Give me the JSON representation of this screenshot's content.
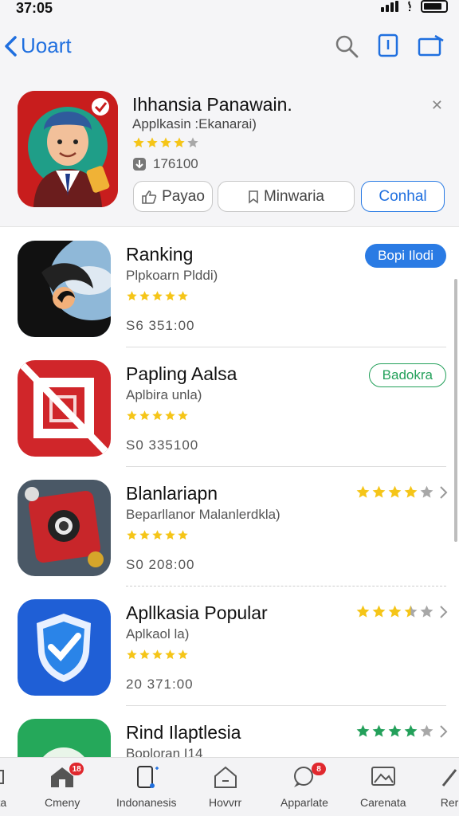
{
  "status": {
    "time": "37:05"
  },
  "header": {
    "back_label": "Uoart"
  },
  "featured": {
    "title": "Ihhansia Panawain.",
    "subtitle": "Applkasin :Ekanarai)",
    "rating": 4,
    "size": "176100",
    "buttons": {
      "first": "Payao",
      "second": "Minwaria",
      "third": "Conhal"
    }
  },
  "apps": [
    {
      "title": "Ranking",
      "subtitle": "Plpkoarn Plddi)",
      "rating": 5,
      "size": "S6  351:00",
      "action": {
        "type": "button",
        "label": "Bopi Ilodi"
      }
    },
    {
      "title": "Papling Aalsa",
      "subtitle": "Aplbira unla)",
      "rating": 5,
      "size": "S0  335100",
      "action": {
        "type": "outline",
        "label": "Badokra"
      }
    },
    {
      "title": "Blanlariapn",
      "subtitle": "Beparllanor Malanlerdkla)",
      "rating": 5,
      "size": "S0  208:00",
      "action": {
        "type": "rating",
        "rating": 4
      }
    },
    {
      "title": "Apllkasia Popular",
      "subtitle": "Aplkaol la)",
      "rating": 5,
      "size": "20  371:00",
      "action": {
        "type": "rating",
        "rating": 3.5
      }
    },
    {
      "title": "Rind Ilaptlesia",
      "subtitle": "Boploran I14",
      "action": {
        "type": "rating",
        "rating": 4,
        "color": "green"
      }
    }
  ],
  "tabs": [
    {
      "label": "rta"
    },
    {
      "label": "Cmeny",
      "badge": "18"
    },
    {
      "label": "Indonanesis"
    },
    {
      "label": "Hovvrr"
    },
    {
      "label": "Apparlate",
      "badge": "8"
    },
    {
      "label": "Carenata"
    },
    {
      "label": "Rer"
    }
  ],
  "colors": {
    "accent": "#1f6fdf",
    "star": "#f5c518",
    "green": "#23a05a",
    "badge": "#e0282e"
  }
}
